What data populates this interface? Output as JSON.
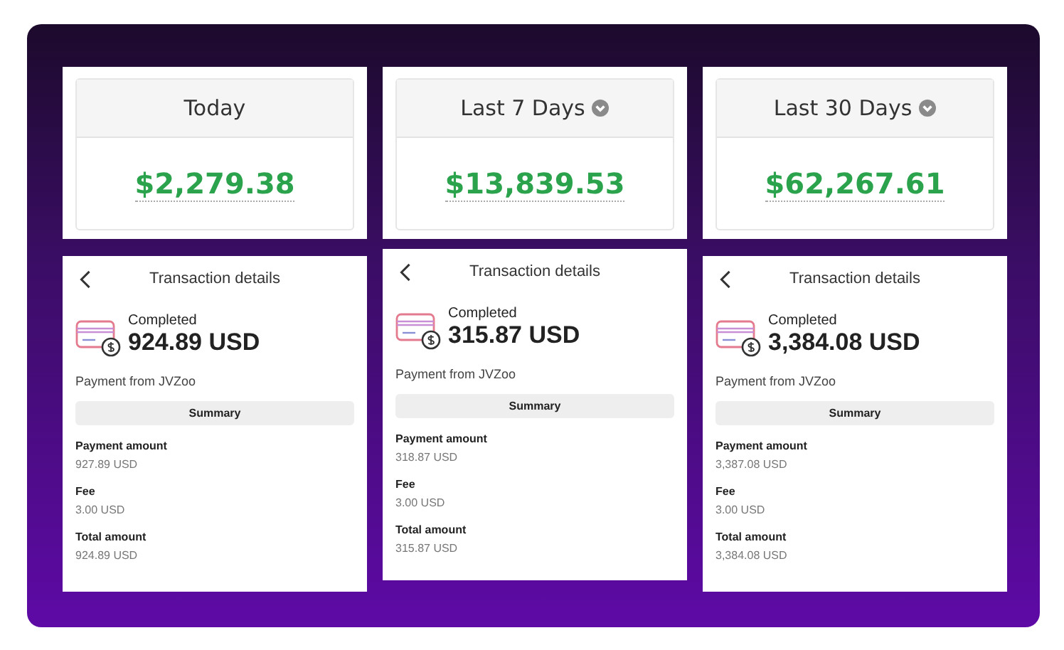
{
  "stats": [
    {
      "label": "Today",
      "dropdown": false,
      "amount": "$2,279.38"
    },
    {
      "label": "Last 7 Days",
      "dropdown": true,
      "amount": "$13,839.53"
    },
    {
      "label": "Last 30 Days",
      "dropdown": true,
      "amount": "$62,267.61"
    }
  ],
  "transactions": [
    {
      "title": "Transaction details",
      "status": "Completed",
      "amount": "924.89 USD",
      "source": "Payment from JVZoo",
      "summary": "Summary",
      "fields": [
        {
          "label": "Payment amount",
          "value": "927.89 USD"
        },
        {
          "label": "Fee",
          "value": "3.00 USD"
        },
        {
          "label": "Total amount",
          "value": "924.89 USD"
        }
      ]
    },
    {
      "title": "Transaction details",
      "status": "Completed",
      "amount": "315.87 USD",
      "source": "Payment from JVZoo",
      "summary": "Summary",
      "fields": [
        {
          "label": "Payment amount",
          "value": "318.87 USD"
        },
        {
          "label": "Fee",
          "value": "3.00 USD"
        },
        {
          "label": "Total amount",
          "value": "315.87 USD"
        }
      ]
    },
    {
      "title": "Transaction details",
      "status": "Completed",
      "amount": "3,384.08 USD",
      "source": "Payment from JVZoo",
      "summary": "Summary",
      "fields": [
        {
          "label": "Payment amount",
          "value": "3,387.08 USD"
        },
        {
          "label": "Fee",
          "value": "3.00 USD"
        },
        {
          "label": "Total amount",
          "value": "3,384.08 USD"
        }
      ]
    }
  ]
}
